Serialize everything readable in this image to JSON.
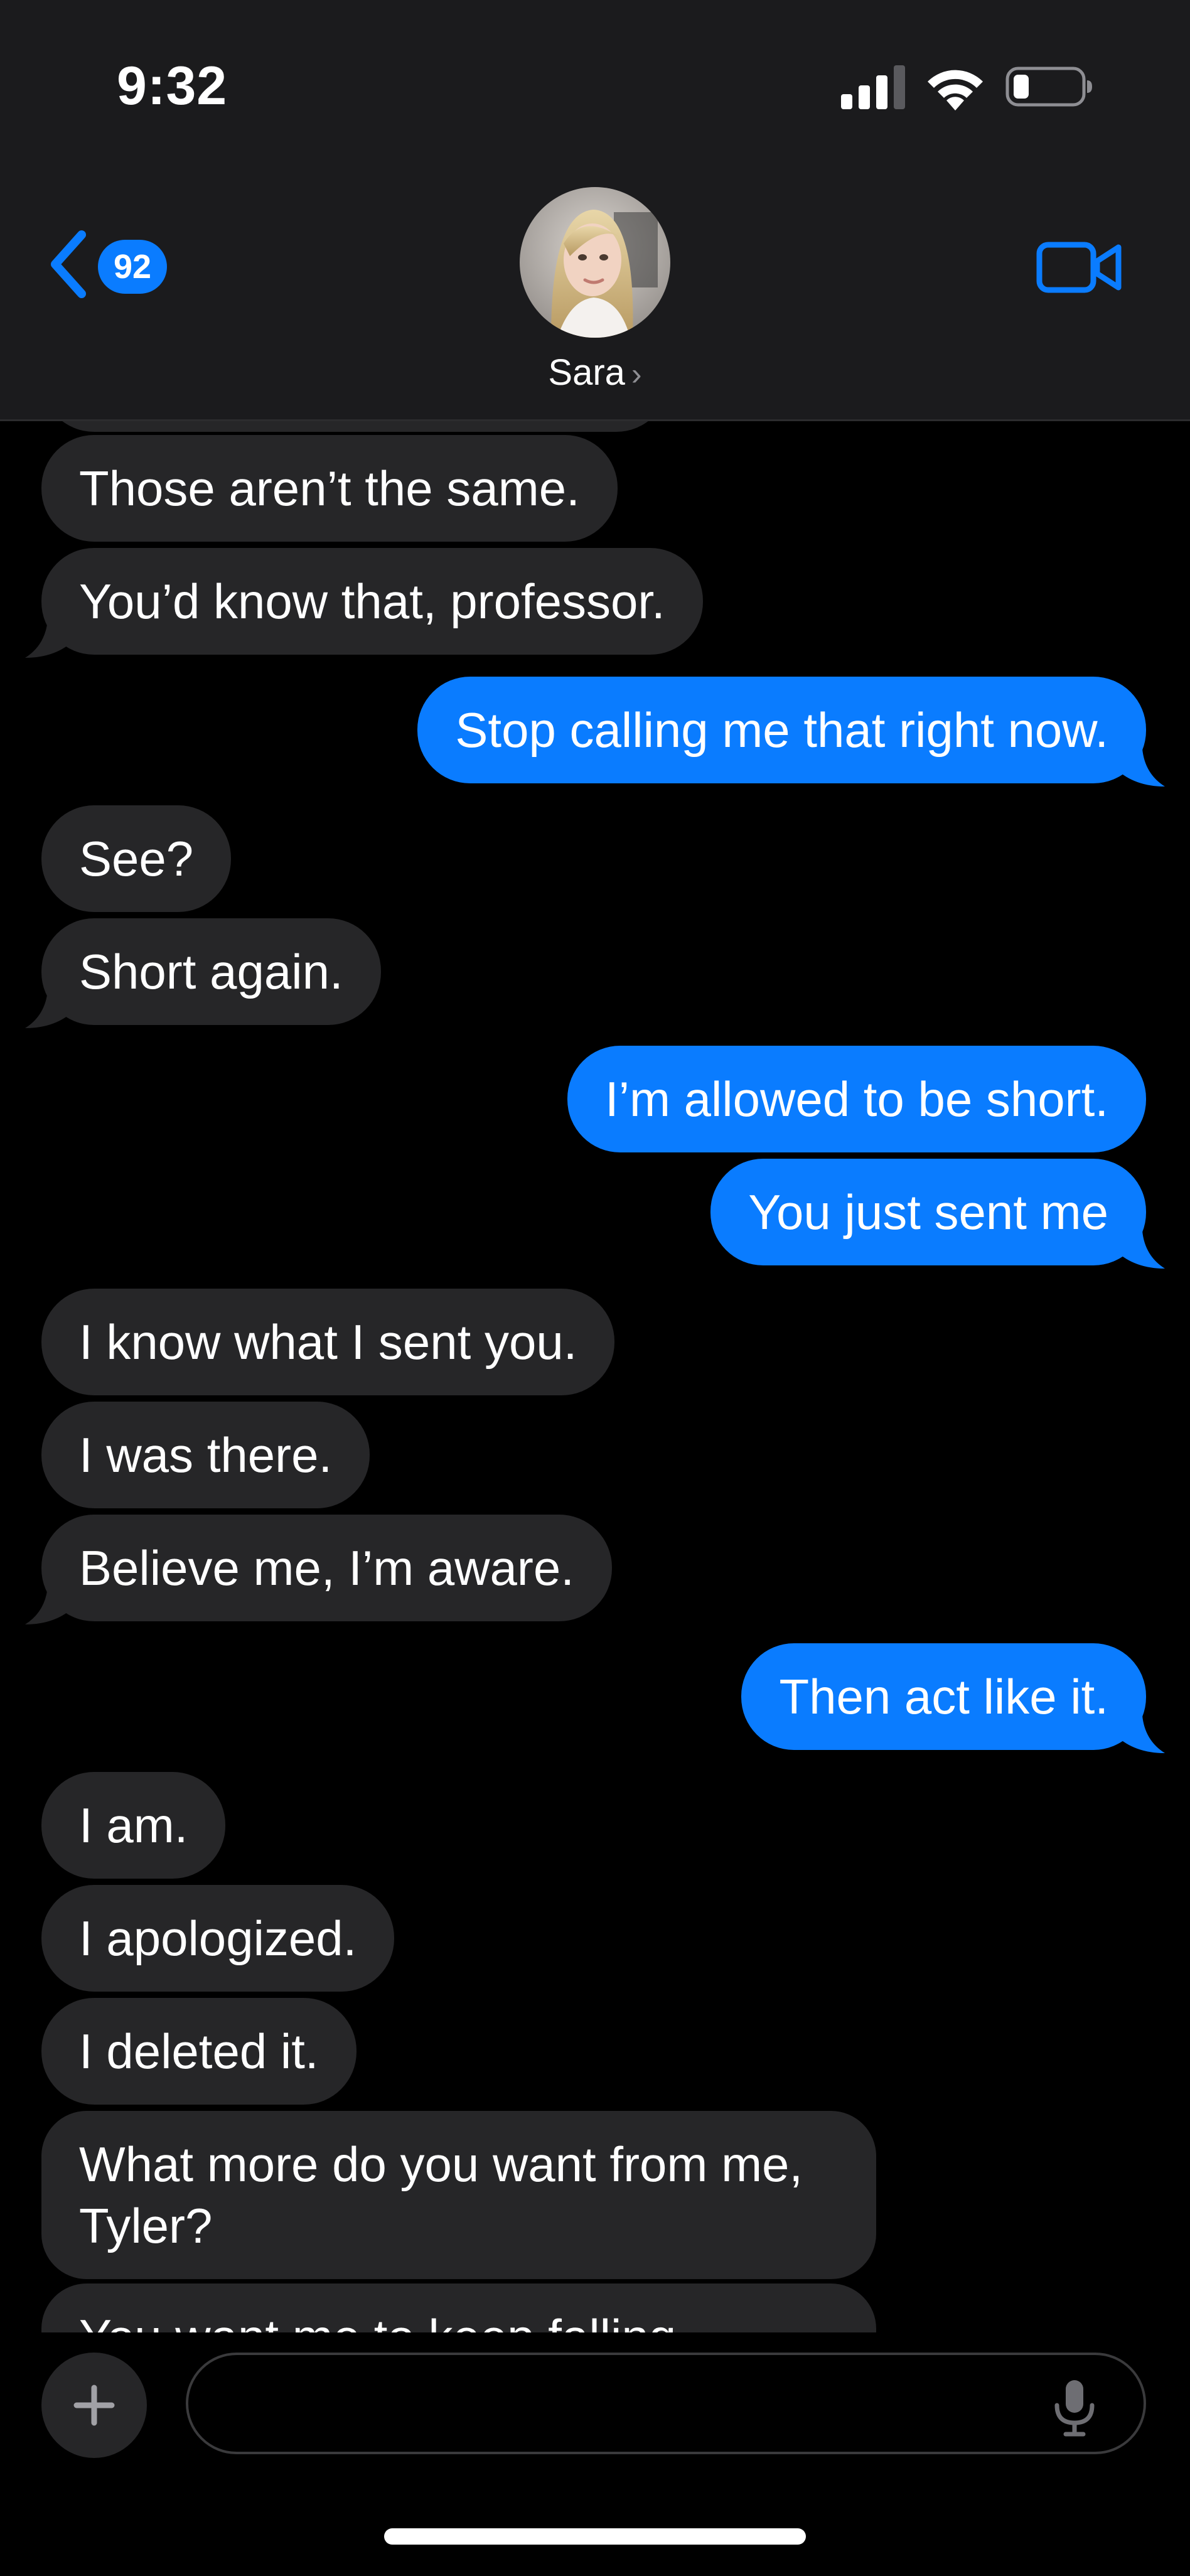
{
  "status_bar": {
    "time": "9:32"
  },
  "header": {
    "back_badge": "92",
    "contact_name": "Sara",
    "name_chevron": "›"
  },
  "messages": [
    {
      "side": "in",
      "text": "Those aren’t the same."
    },
    {
      "side": "in",
      "text": "You’d know that, professor."
    },
    {
      "side": "out",
      "text": "Stop calling me that right now."
    },
    {
      "side": "in",
      "text": "See?"
    },
    {
      "side": "in",
      "text": "Short again."
    },
    {
      "side": "out",
      "text": "I’m allowed to be short."
    },
    {
      "side": "out",
      "text": "You just sent me"
    },
    {
      "side": "in",
      "text": "I know what I sent you."
    },
    {
      "side": "in",
      "text": "I was there."
    },
    {
      "side": "in",
      "text": "Believe me, I’m aware."
    },
    {
      "side": "out",
      "text": "Then act like it."
    },
    {
      "side": "in",
      "text": "I am."
    },
    {
      "side": "in",
      "text": "I apologized."
    },
    {
      "side": "in",
      "text": "I deleted it."
    },
    {
      "side": "in",
      "text": "What more do you want from me, Tyler?"
    },
    {
      "side": "in",
      "text": "You want me to keep falling"
    }
  ],
  "compose": {
    "placeholder": ""
  },
  "icons": {
    "signal": "cellular-signal-icon",
    "wifi": "wifi-icon",
    "battery": "battery-icon",
    "back": "chevron-left-icon",
    "video": "video-camera-icon",
    "plus": "plus-icon",
    "mic": "microphone-icon"
  },
  "colors": {
    "accent": "#0a7cff",
    "incoming_bubble": "#262628",
    "header_bg": "#1b1b1d",
    "background": "#000000"
  }
}
